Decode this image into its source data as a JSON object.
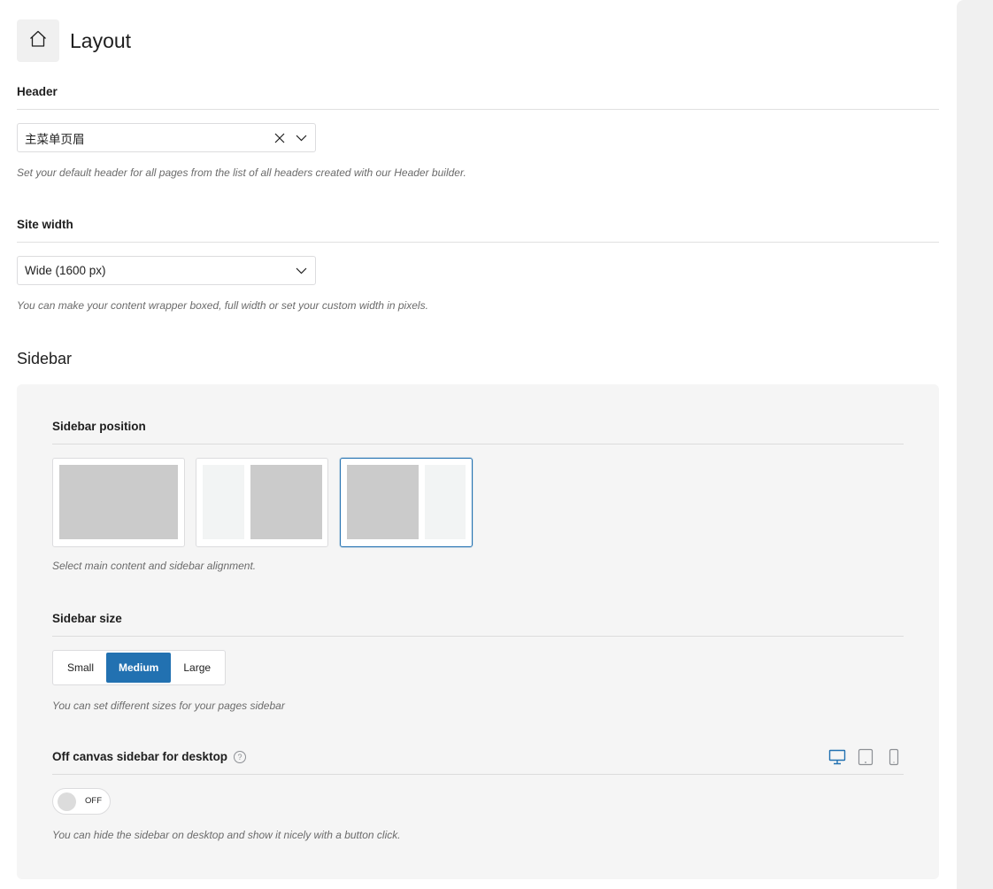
{
  "page": {
    "title": "Layout",
    "home_icon": "home-icon"
  },
  "header_section": {
    "label": "Header",
    "select_value": "主菜单页眉",
    "help": "Set your default header for all pages from the list of all headers created with our Header builder."
  },
  "site_width_section": {
    "label": "Site width",
    "select_value": "Wide (1600 px)",
    "help": "You can make your content wrapper boxed, full width or set your custom width in pixels."
  },
  "sidebar": {
    "heading": "Sidebar",
    "position": {
      "label": "Sidebar position",
      "options": [
        "no-sidebar",
        "left-sidebar",
        "right-sidebar"
      ],
      "selected": "right-sidebar",
      "help": "Select main content and sidebar alignment."
    },
    "size": {
      "label": "Sidebar size",
      "options": [
        "Small",
        "Medium",
        "Large"
      ],
      "selected": "Medium",
      "help": "You can set different sizes for your pages sidebar"
    },
    "off_canvas": {
      "label": "Off canvas sidebar for desktop",
      "help_icon_text": "?",
      "toggle_text": "OFF",
      "devices": [
        "desktop-icon",
        "tablet-icon",
        "mobile-icon"
      ],
      "active_device": "desktop-icon",
      "help": "You can hide the sidebar on desktop and show it nicely with a button click."
    }
  },
  "colors": {
    "accent": "#2271b1",
    "panel_bg": "#f5f5f5",
    "placeholder_block": "#cbcbcb"
  }
}
